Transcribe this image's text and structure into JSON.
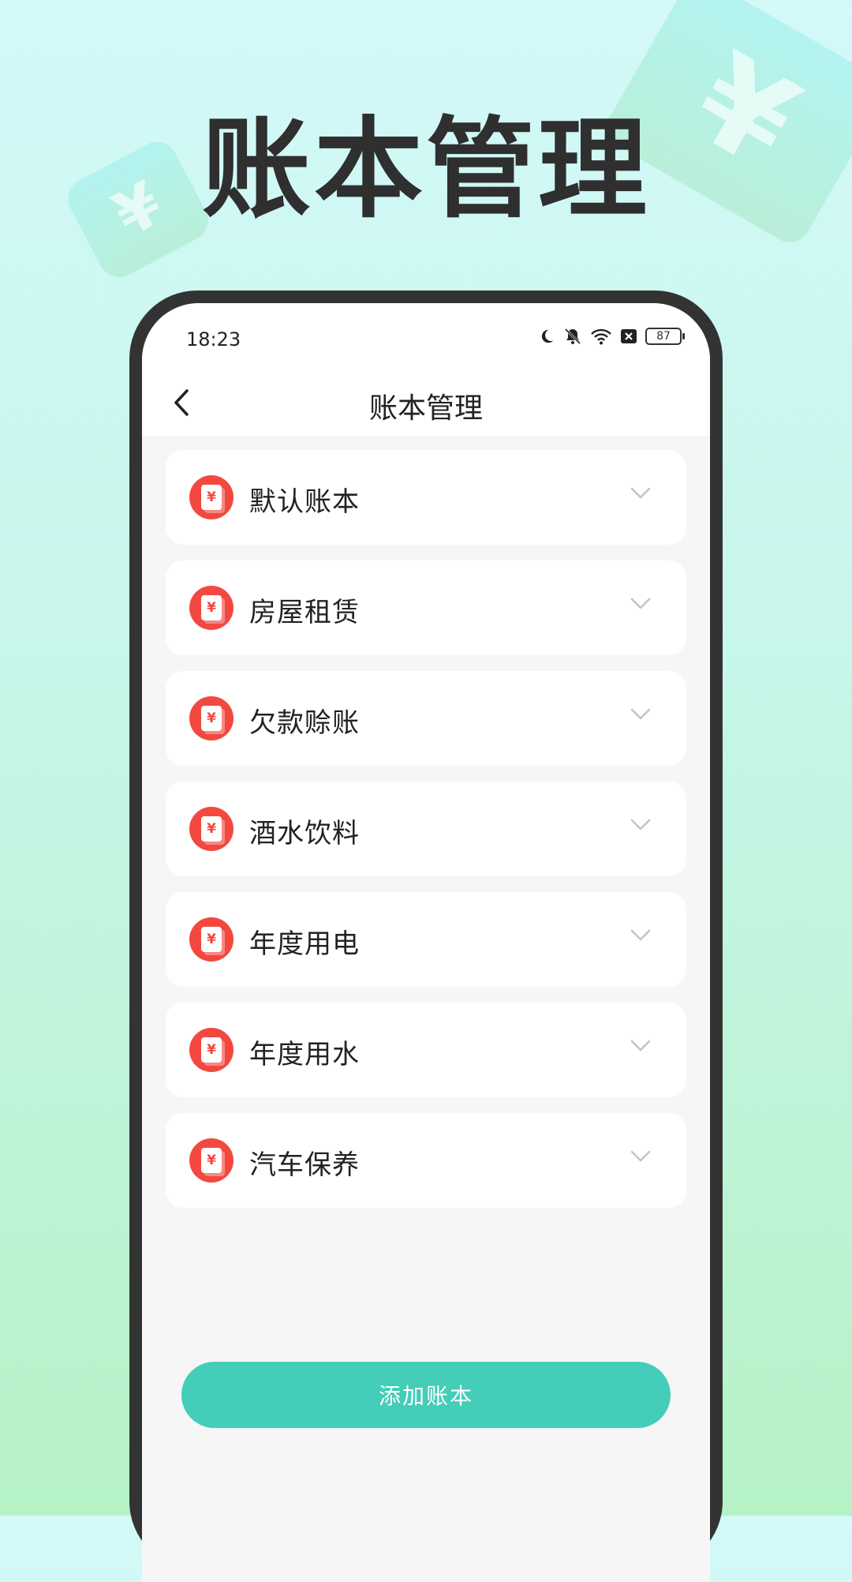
{
  "headline": "账本管理",
  "status_bar": {
    "time": "18:23",
    "battery": "87",
    "icons": [
      "moon-icon",
      "bell-off-icon",
      "wifi-icon",
      "close-box-icon",
      "battery-icon"
    ]
  },
  "navbar": {
    "back_icon": "chevron-left-icon",
    "title": "账本管理"
  },
  "books": [
    {
      "label": "默认账本",
      "icon": "red-envelope-icon",
      "chevron": "chevron-down-icon"
    },
    {
      "label": "房屋租赁",
      "icon": "red-envelope-icon",
      "chevron": "chevron-down-icon"
    },
    {
      "label": "欠款赊账",
      "icon": "red-envelope-icon",
      "chevron": "chevron-down-icon"
    },
    {
      "label": "酒水饮料",
      "icon": "red-envelope-icon",
      "chevron": "chevron-down-icon"
    },
    {
      "label": "年度用电",
      "icon": "red-envelope-icon",
      "chevron": "chevron-down-icon"
    },
    {
      "label": "年度用水",
      "icon": "red-envelope-icon",
      "chevron": "chevron-down-icon"
    },
    {
      "label": "汽车保养",
      "icon": "red-envelope-icon",
      "chevron": "chevron-down-icon"
    }
  ],
  "icon_glyph": "¥",
  "add_button": "添加账本",
  "colors": {
    "accent": "#44cdb8",
    "icon_red": "#f3483f",
    "bg_top": "#d3f9f8",
    "bg_bottom": "#b6f2c6"
  }
}
